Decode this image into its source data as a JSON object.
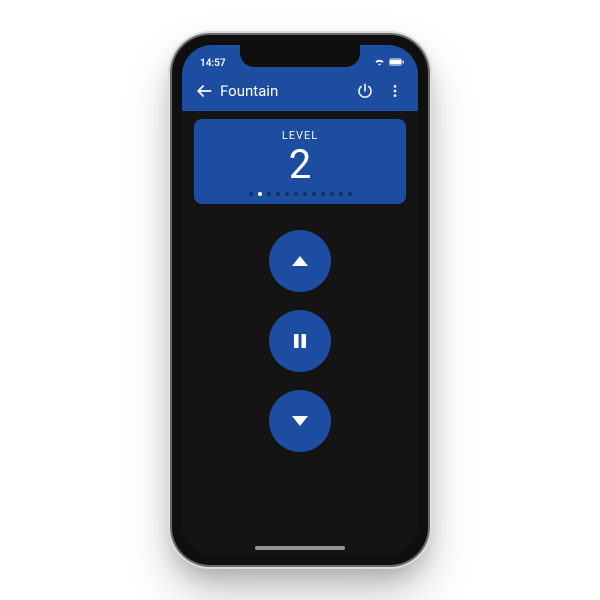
{
  "colors": {
    "accent": "#1c4da0",
    "screen_bg": "#141415"
  },
  "statusbar": {
    "time": "14:57"
  },
  "appbar": {
    "title": "Fountain"
  },
  "level_card": {
    "label": "LEVEL",
    "value": "2",
    "total_dots": 12,
    "active_dot_index": 1
  }
}
